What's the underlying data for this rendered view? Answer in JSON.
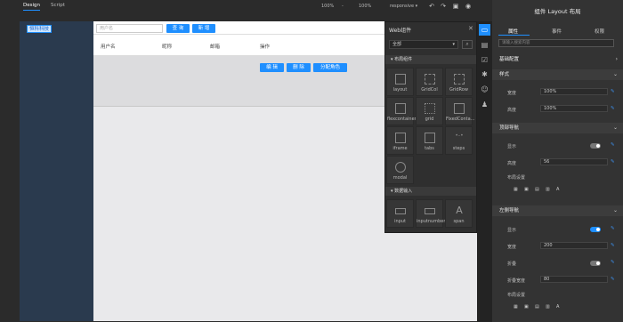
{
  "topbar": {
    "tabs": [
      "Design",
      "Script"
    ],
    "zoom_left": "100%",
    "zoom_right": "100%",
    "device": "responsive",
    "icons": [
      "undo-icon",
      "redo-icon",
      "save-icon",
      "preview-icon"
    ]
  },
  "canvas": {
    "logo_text": "恒科科技",
    "search_placeholder": "用户名",
    "query_button": "查 询",
    "new_button": "新 增",
    "columns": [
      "用户名",
      "昵称",
      "邮箱",
      "操作"
    ],
    "row_actions": [
      "编 辑",
      "删 除",
      "分配角色"
    ]
  },
  "widget_panel": {
    "title": "Web组件",
    "filter_value": "全部",
    "categories": [
      {
        "label": "布局组件",
        "items": [
          "layout",
          "GridCol",
          "GridRow",
          "flexcontainer",
          "grid",
          "FixedConta...",
          "iframe",
          "tabs",
          "steps",
          "modal"
        ]
      },
      {
        "label": "数据输入",
        "items": [
          "input",
          "inputnumber",
          "span"
        ]
      }
    ]
  },
  "right_panel": {
    "title": "组件 Layout 布局",
    "tabs": [
      "属性",
      "事件",
      "权限"
    ],
    "search_placeholder": "请输入搜索内容",
    "sections": {
      "basic": "基础配置",
      "style": "样式",
      "top_nav": "顶部导航",
      "left_nav": "左侧导航"
    },
    "style": {
      "width_label": "宽度",
      "width_value": "100%",
      "height_label": "高度",
      "height_value": "100%"
    },
    "top_nav": {
      "show_label": "显示",
      "height_label": "高度",
      "height_value": "56",
      "layout_label": "布局设置"
    },
    "left_nav": {
      "show_label": "显示",
      "width_label": "宽度",
      "width_value": "200",
      "collapse_label": "折叠",
      "collapse_width_label": "折叠宽度",
      "collapse_width_value": "80",
      "layout_label": "布局设置"
    },
    "layout_glyphs": [
      "▦",
      "▣",
      "▤",
      "▥",
      "▧",
      "A"
    ]
  },
  "colors": {
    "accent": "#1f8fff",
    "sidebar": "#2a3a4e"
  }
}
